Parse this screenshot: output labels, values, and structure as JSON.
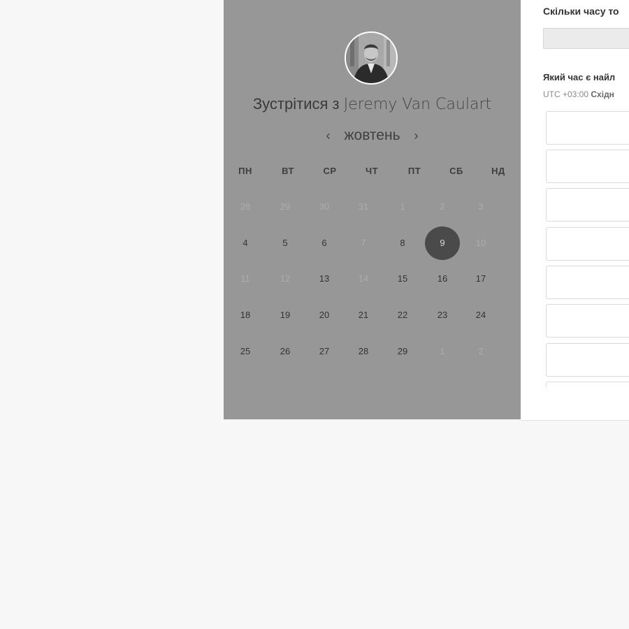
{
  "booking": {
    "title_prefix": "Зустрітися з",
    "host_name": "Jeremy Van Caulart",
    "avatar_icon": "host-avatar-photo"
  },
  "calendar": {
    "month": "жовтень",
    "prev_icon": "chevron-left-icon",
    "next_icon": "chevron-right-icon",
    "prev_glyph": "‹",
    "next_glyph": "›",
    "weekdays": [
      "ПН",
      "ВТ",
      "СР",
      "ЧТ",
      "ПТ",
      "СБ",
      "НД"
    ],
    "weeks": [
      [
        "28",
        "29",
        "30",
        "31",
        "1",
        "2",
        "3"
      ],
      [
        "4",
        "5",
        "6",
        "7",
        "8",
        "9",
        "10"
      ],
      [
        "11",
        "12",
        "13",
        "14",
        "15",
        "16",
        "17"
      ],
      [
        "18",
        "19",
        "20",
        "21",
        "22",
        "23",
        "24"
      ],
      [
        "25",
        "26",
        "27",
        "28",
        "29",
        "1",
        "2"
      ]
    ],
    "unavailable": [
      [
        true,
        true,
        true,
        true,
        true,
        true,
        true
      ],
      [
        false,
        false,
        false,
        true,
        false,
        false,
        true
      ],
      [
        true,
        true,
        false,
        true,
        false,
        false,
        false
      ],
      [
        false,
        false,
        false,
        false,
        false,
        false,
        false
      ],
      [
        false,
        false,
        false,
        false,
        false,
        true,
        true
      ]
    ],
    "selected_day": "9"
  },
  "details": {
    "duration_question": "Скільки часу то",
    "time_question": "Який час є найл",
    "timezone_offset": "UTC +03:00",
    "timezone_name": "Східн"
  },
  "colors": {
    "left_panel": "#979797",
    "selected_day": "#4a4a4a",
    "page_background": "#f7f7f7"
  }
}
